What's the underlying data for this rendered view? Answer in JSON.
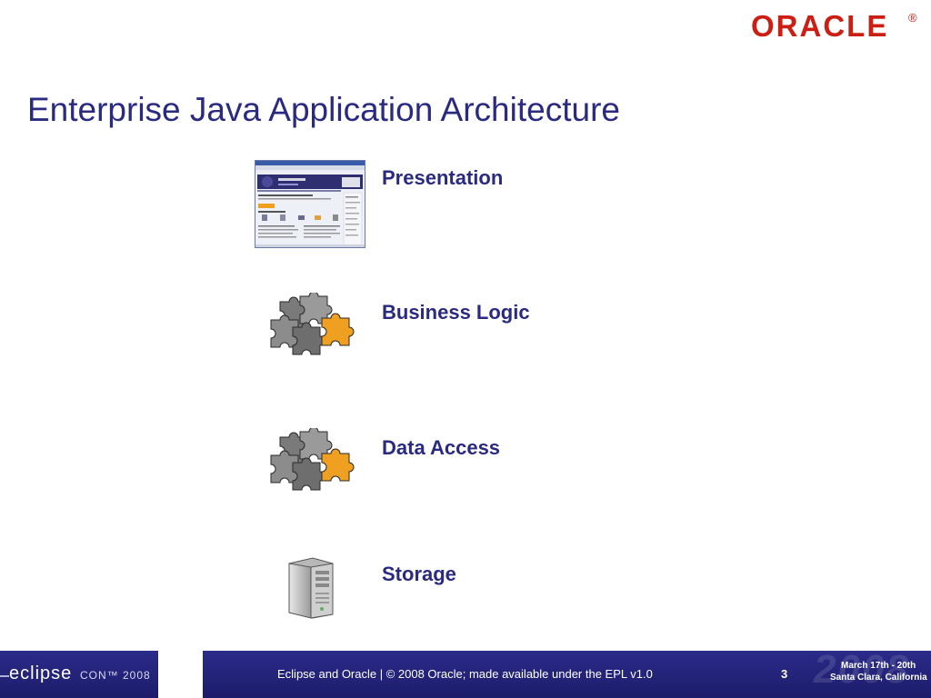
{
  "header": {
    "logo_text": "ORACLE",
    "logo_mark": "®"
  },
  "slide": {
    "title": "Enterprise Java Application Architecture",
    "layers": [
      {
        "label": "Presentation",
        "icon": "browser-screenshot-icon"
      },
      {
        "label": "Business Logic",
        "icon": "puzzle-pieces-icon"
      },
      {
        "label": "Data Access",
        "icon": "puzzle-pieces-icon"
      },
      {
        "label": "Storage",
        "icon": "server-tower-icon"
      }
    ]
  },
  "footer": {
    "eclipse_logo": "eclipse",
    "eclipse_con": "CON™ 2008",
    "text": "Eclipse and Oracle  |  © 2008 Oracle; made available under the EPL v1.0",
    "page_number": "3",
    "watermark": "2008",
    "dates_line1": "March 17th - 20th",
    "dates_line2": "Santa Clara, California"
  },
  "colors": {
    "title": "#2a2a80",
    "brand_red": "#cc1e12",
    "footer_bg": "#23237a",
    "puzzle_orange": "#f0a020"
  }
}
